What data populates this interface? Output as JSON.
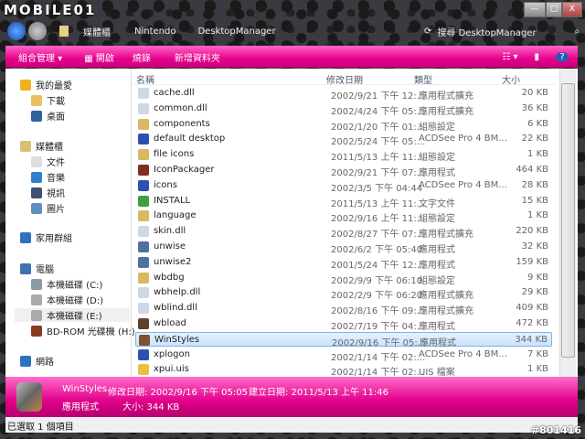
{
  "logo": "MOBILE01",
  "address": {
    "crumbs": [
      "媒體櫃",
      "Nintendo",
      "DesktopManager"
    ],
    "search_placeholder": "搜尋 DesktopManager"
  },
  "toolbar": {
    "organize": "組合管理 ▾",
    "open": "開啟",
    "burn": "燒錄",
    "new_folder": "新增資料夾"
  },
  "sidebar": {
    "items": [
      {
        "label": "我的最愛",
        "icon": "star-icon",
        "color": "#f0b020",
        "indent": 0
      },
      {
        "label": "下載",
        "icon": "downloads-folder-icon",
        "color": "#e8c060",
        "indent": 1
      },
      {
        "label": "桌面",
        "icon": "desktop-icon",
        "color": "#3060a0",
        "indent": 1
      },
      {
        "label": "媒體櫃",
        "icon": "library-icon",
        "color": "#d8c070",
        "indent": 0
      },
      {
        "label": "文件",
        "icon": "document-icon",
        "color": "#ddd",
        "indent": 1
      },
      {
        "label": "音樂",
        "icon": "music-icon",
        "color": "#3080d0",
        "indent": 1
      },
      {
        "label": "視訊",
        "icon": "video-icon",
        "color": "#405070",
        "indent": 1
      },
      {
        "label": "圖片",
        "icon": "picture-icon",
        "color": "#6090c0",
        "indent": 1
      },
      {
        "label": "家用群組",
        "icon": "homegroup-icon",
        "color": "#3070c0",
        "indent": 0
      },
      {
        "label": "電腦",
        "icon": "computer-icon",
        "color": "#4070b0",
        "indent": 0
      },
      {
        "label": "本機磁碟 (C:)",
        "icon": "drive-icon",
        "color": "#8a9aa0",
        "indent": 1
      },
      {
        "label": "本機磁碟 (D:)",
        "icon": "drive-icon",
        "color": "#aaa",
        "indent": 1
      },
      {
        "label": "本機磁碟 (E:)",
        "icon": "drive-icon",
        "color": "#aaa",
        "indent": 1
      },
      {
        "label": "BD-ROM 光碟機 (H:)",
        "icon": "bd-rom-icon",
        "color": "#8a3a20",
        "indent": 1
      },
      {
        "label": "網路",
        "icon": "network-icon",
        "color": "#3070c0",
        "indent": 0
      }
    ]
  },
  "columns": {
    "name": "名稱",
    "date": "修改日期",
    "type": "類型",
    "size": "大小"
  },
  "files": [
    {
      "name": "cache.dll",
      "date": "2002/9/21 下午 12:...",
      "type": "應用程式擴充",
      "size": "20 KB",
      "color": "#cfd8e4"
    },
    {
      "name": "common.dll",
      "date": "2002/4/24 下午 05:...",
      "type": "應用程式擴充",
      "size": "36 KB",
      "color": "#cfd8e4"
    },
    {
      "name": "components",
      "date": "2002/1/20 下午 01:...",
      "type": "組態設定",
      "size": "6 KB",
      "color": "#d8b860"
    },
    {
      "name": "default desktop",
      "date": "2002/5/24 下午 05:...",
      "type": "ACDSee Pro 4 BM...",
      "size": "22 KB",
      "color": "#3050b0"
    },
    {
      "name": "file icons",
      "date": "2011/5/13 上午 11:...",
      "type": "組態設定",
      "size": "1 KB",
      "color": "#d8b860"
    },
    {
      "name": "IconPackager",
      "date": "2002/9/21 下午 07:...",
      "type": "應用程式",
      "size": "464 KB",
      "color": "#803020"
    },
    {
      "name": "icons",
      "date": "2002/3/5 下午 04:44",
      "type": "ACDSee Pro 4 BM...",
      "size": "28 KB",
      "color": "#3050b0"
    },
    {
      "name": "INSTALL",
      "date": "2011/5/13 上午 11:...",
      "type": "文字文件",
      "size": "15 KB",
      "color": "#40a040"
    },
    {
      "name": "language",
      "date": "2002/9/16 上午 11:...",
      "type": "組態設定",
      "size": "1 KB",
      "color": "#d8b860"
    },
    {
      "name": "skin.dll",
      "date": "2002/8/27 下午 07:...",
      "type": "應用程式擴充",
      "size": "220 KB",
      "color": "#cfd8e4"
    },
    {
      "name": "unwise",
      "date": "2002/6/2 下午 05:40",
      "type": "應用程式",
      "size": "32 KB",
      "color": "#5070a0"
    },
    {
      "name": "unwise2",
      "date": "2001/5/24 下午 12:...",
      "type": "應用程式",
      "size": "159 KB",
      "color": "#5070a0"
    },
    {
      "name": "wbdbg",
      "date": "2002/9/9 下午 06:10",
      "type": "組態設定",
      "size": "9 KB",
      "color": "#d8b860"
    },
    {
      "name": "wbhelp.dll",
      "date": "2002/2/9 下午 06:20",
      "type": "應用程式擴充",
      "size": "29 KB",
      "color": "#cfd8e4"
    },
    {
      "name": "wblind.dll",
      "date": "2002/8/16 下午 09:...",
      "type": "應用程式擴充",
      "size": "409 KB",
      "color": "#cfd8e4"
    },
    {
      "name": "wbload",
      "date": "2002/7/19 下午 04:...",
      "type": "應用程式",
      "size": "472 KB",
      "color": "#604030"
    },
    {
      "name": "WinStyles",
      "date": "2002/9/16 下午 05:...",
      "type": "應用程式",
      "size": "344 KB",
      "color": "#805030",
      "selected": true
    },
    {
      "name": "xplogon",
      "date": "2002/1/14 下午 02:...",
      "type": "ACDSee Pro 4 BM...",
      "size": "7 KB",
      "color": "#3050b0"
    },
    {
      "name": "xpui.uis",
      "date": "2002/1/14 下午 02:...",
      "type": "UIS 檔案",
      "size": "1 KB",
      "color": "#e8c040"
    }
  ],
  "details": {
    "name": "WinStyles",
    "modified": "修改日期: 2002/9/16 下午 05:05",
    "created": "建立日期: 2011/5/13 上午 11:46",
    "type": "應用程式",
    "size": "大小: 344 KB"
  },
  "status": "已選取 1 個項目",
  "watermark": "#801416"
}
